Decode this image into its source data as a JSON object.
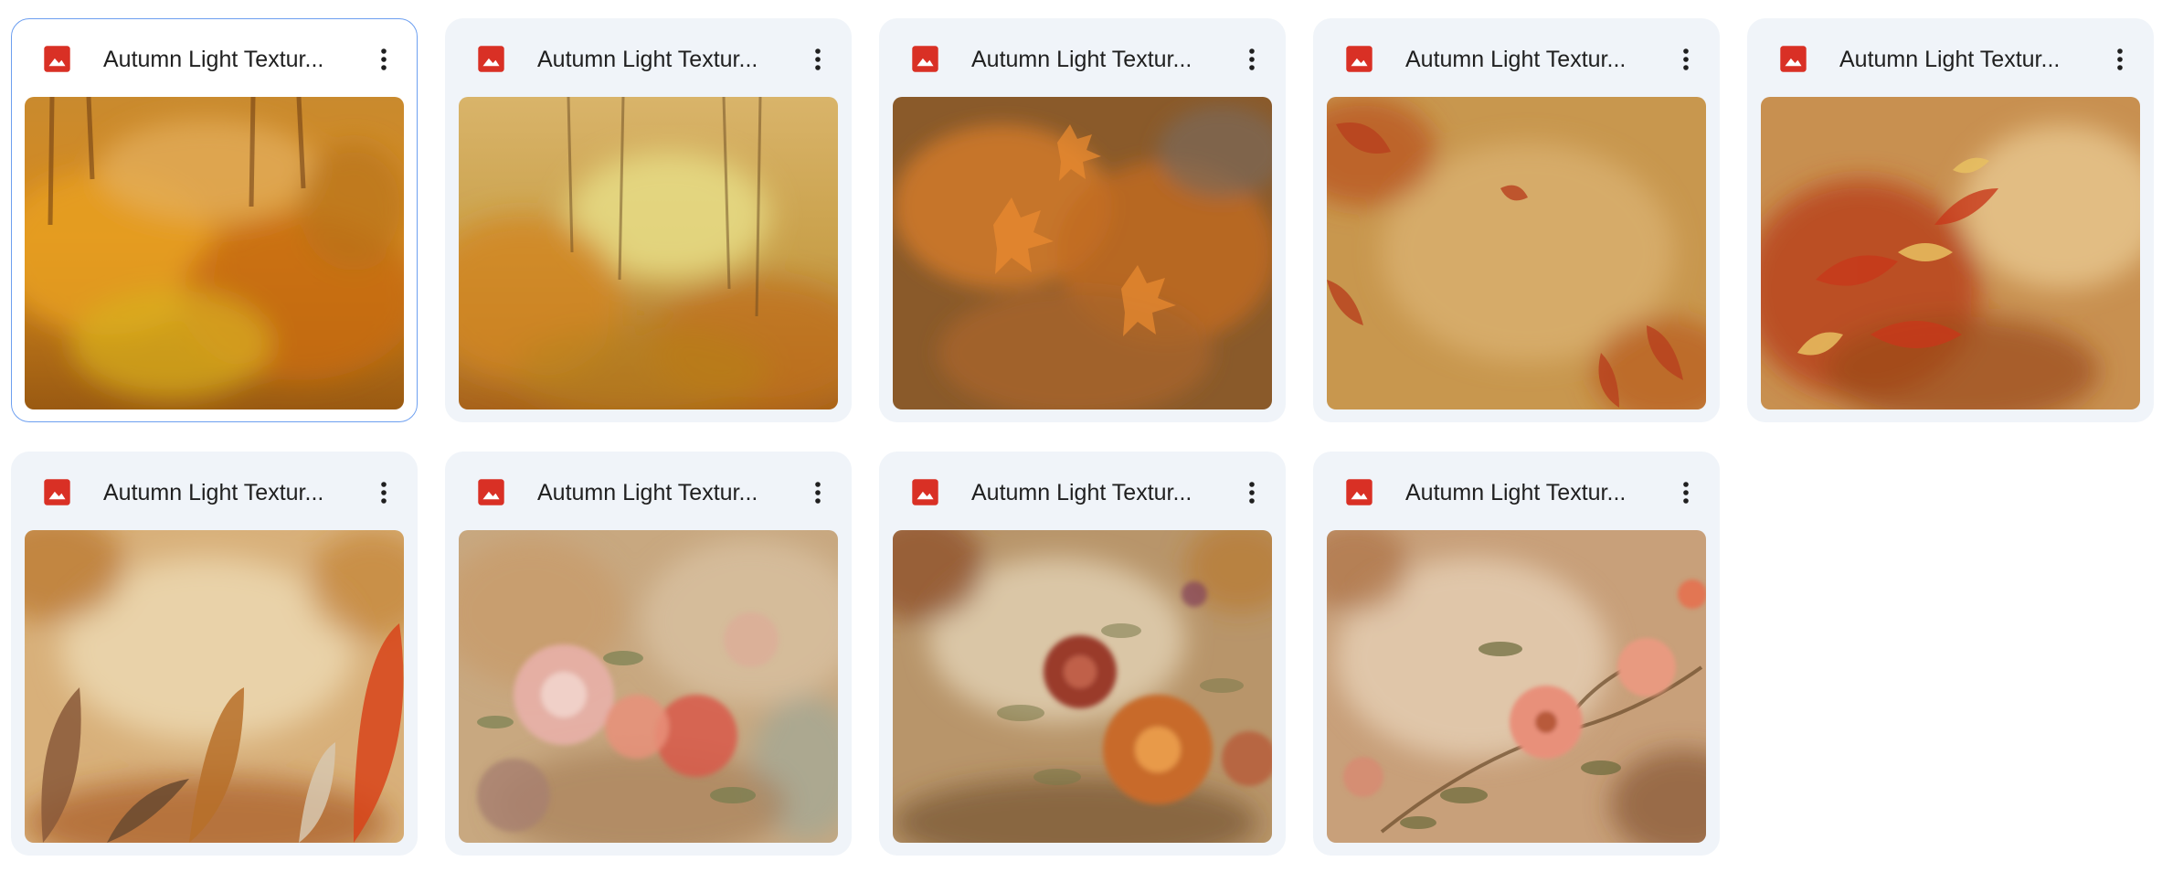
{
  "colors": {
    "card_background": "#f0f4f9",
    "selected_border": "#6d9ff0",
    "file_icon_red": "#d93025",
    "text_primary": "#1f1f1f"
  },
  "files": [
    {
      "name": "Autumn Light Textur...",
      "type_icon": "image-file-icon",
      "selected": true,
      "thumbnail": "misty autumn forest, orange and yellow foliage"
    },
    {
      "name": "Autumn Light Textur...",
      "type_icon": "image-file-icon",
      "selected": false,
      "thumbnail": "golden autumn forest with bare trees"
    },
    {
      "name": "Autumn Light Textur...",
      "type_icon": "image-file-icon",
      "selected": false,
      "thumbnail": "orange maple leaves on branches"
    },
    {
      "name": "Autumn Light Textur...",
      "type_icon": "image-file-icon",
      "selected": false,
      "thumbnail": "parchment texture with scattered autumn leaves"
    },
    {
      "name": "Autumn Light Textur...",
      "type_icon": "image-file-icon",
      "selected": false,
      "thumbnail": "red and gold autumn leaves spray"
    },
    {
      "name": "Autumn Light Textur...",
      "type_icon": "image-file-icon",
      "selected": false,
      "thumbnail": "cream texture with feather leaves at bottom"
    },
    {
      "name": "Autumn Light Textur...",
      "type_icon": "image-file-icon",
      "selected": false,
      "thumbnail": "pink dahlia floral texture"
    },
    {
      "name": "Autumn Light Textur...",
      "type_icon": "image-file-icon",
      "selected": false,
      "thumbnail": "red peony and orange dahlia flowers"
    },
    {
      "name": "Autumn Light Textur...",
      "type_icon": "image-file-icon",
      "selected": false,
      "thumbnail": "peach flowers on branch texture"
    }
  ],
  "menu_icon": "more-vert-icon"
}
